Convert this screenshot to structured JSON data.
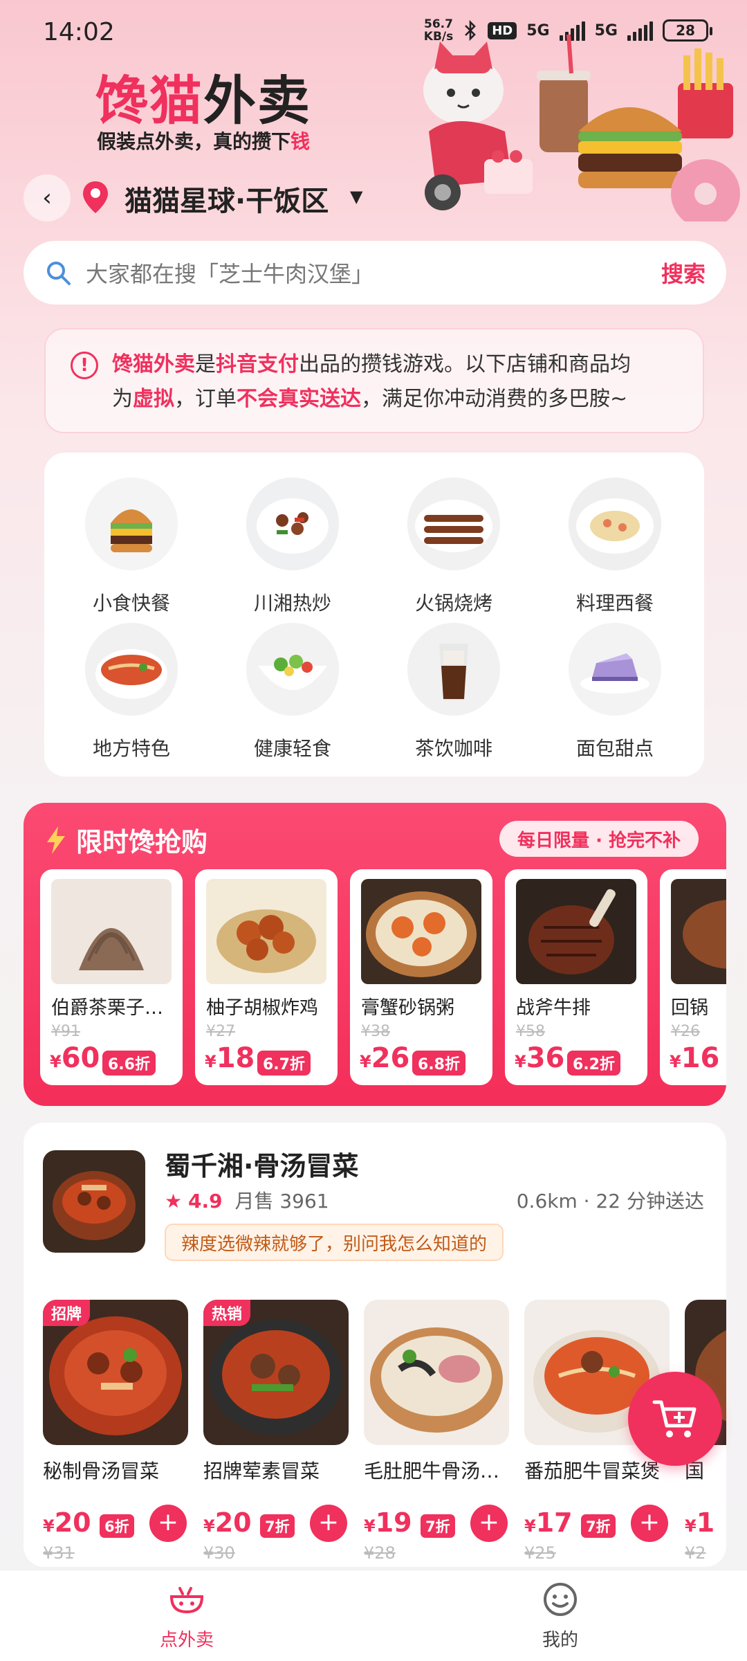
{
  "status_bar": {
    "time": "14:02",
    "net_speed_top": "56.7",
    "net_speed_bottom": "KB/s",
    "hd": "HD",
    "net1": "5G",
    "net2": "5G",
    "battery": "28"
  },
  "header": {
    "brand_part1": "馋猫",
    "brand_part2": "外卖",
    "slogan_main": "假装点外卖，真的攒下",
    "slogan_highlight": "钱",
    "location": "猫猫星球·干饭区"
  },
  "search": {
    "placeholder": "大家都在搜「芝士牛肉汉堡」",
    "button": "搜索"
  },
  "notice": {
    "brand": "馋猫外卖",
    "t1": "是",
    "pay": "抖音支付",
    "t2": "出品的攒钱游戏。以下店铺和商品均",
    "t3": "为",
    "virtual": "虚拟",
    "t4": "，订单",
    "no_delivery": "不会真实送达",
    "t5": "，满足你冲动消费的多巴胺~"
  },
  "categories": [
    {
      "label": "小食快餐"
    },
    {
      "label": "川湘热炒"
    },
    {
      "label": "火锅烧烤"
    },
    {
      "label": "料理西餐"
    },
    {
      "label": "地方特色"
    },
    {
      "label": "健康轻食"
    },
    {
      "label": "茶饮咖啡"
    },
    {
      "label": "面包甜点"
    }
  ],
  "flash_sale": {
    "title": "限时馋抢购",
    "tag": "每日限量 · 抢完不补",
    "items": [
      {
        "name": "伯爵茶栗子…",
        "orig": "¥91",
        "currency": "¥",
        "price": "60",
        "discount": "6.6折"
      },
      {
        "name": "柚子胡椒炸鸡",
        "orig": "¥27",
        "currency": "¥",
        "price": "18",
        "discount": "6.7折"
      },
      {
        "name": "膏蟹砂锅粥",
        "orig": "¥38",
        "currency": "¥",
        "price": "26",
        "discount": "6.8折"
      },
      {
        "name": "战斧牛排",
        "orig": "¥58",
        "currency": "¥",
        "price": "36",
        "discount": "6.2折"
      },
      {
        "name": "回锅",
        "orig": "¥26",
        "currency": "¥",
        "price": "16",
        "discount": ""
      }
    ]
  },
  "shop": {
    "name": "蜀千湘·骨汤冒菜",
    "rating": "4.9",
    "sales": "月售 3961",
    "distance": "0.6km · 22 分钟送达",
    "tip": "辣度选微辣就够了，别问我怎么知道的",
    "dishes": [
      {
        "badge": "招牌",
        "name": "秘制骨汤冒菜",
        "currency": "¥",
        "price": "20",
        "discount": "6折",
        "orig": "¥31"
      },
      {
        "badge": "热销",
        "name": "招牌荤素冒菜",
        "currency": "¥",
        "price": "20",
        "discount": "7折",
        "orig": "¥30"
      },
      {
        "badge": "",
        "name": "毛肚肥牛骨汤…",
        "currency": "¥",
        "price": "19",
        "discount": "7折",
        "orig": "¥28"
      },
      {
        "badge": "",
        "name": "番茄肥牛冒菜煲",
        "currency": "¥",
        "price": "17",
        "discount": "7折",
        "orig": "¥25"
      },
      {
        "badge": "",
        "name": "国",
        "currency": "¥",
        "price": "1",
        "discount": "",
        "orig": "¥2"
      }
    ]
  },
  "bottom_nav": {
    "order": "点外卖",
    "me": "我的"
  },
  "colors": {
    "accent": "#f0305d",
    "flash_bg": "#f73d66",
    "text": "#222222"
  }
}
